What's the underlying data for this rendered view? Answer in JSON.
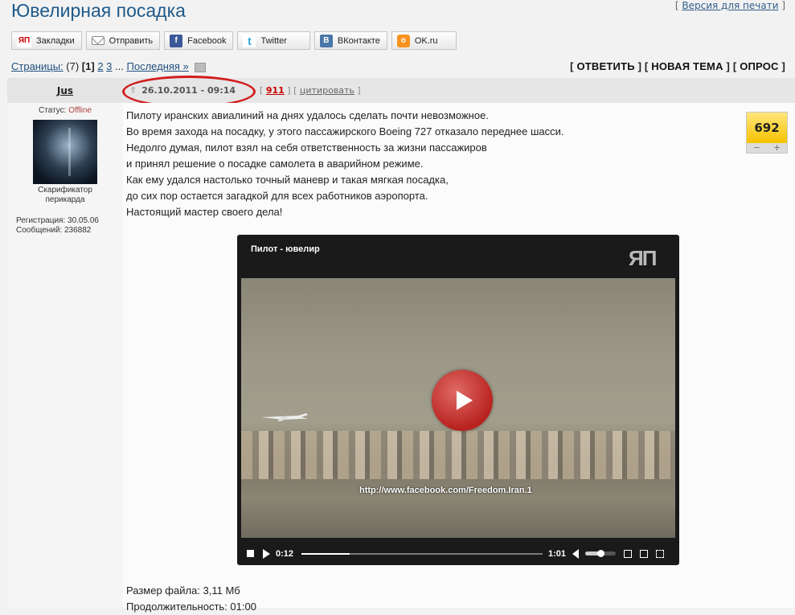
{
  "page": {
    "title": "Ювелирная посадка",
    "print_link": "Версия для печати"
  },
  "share": [
    {
      "label": "Закладки",
      "icon": "ЯП"
    },
    {
      "label": "Отправить",
      "icon": ""
    },
    {
      "label": "Facebook",
      "icon": "f"
    },
    {
      "label": "Twitter",
      "icon": "t"
    },
    {
      "label": "ВКонтакте",
      "icon": "В"
    },
    {
      "label": "OK.ru",
      "icon": "о"
    }
  ],
  "pagination": {
    "label": "Страницы:",
    "count": "(7)",
    "current": "[1]",
    "p2": "2",
    "p3": "3",
    "ellipsis": "...",
    "last": "Последняя »"
  },
  "actions": {
    "reply": "ОТВЕТИТЬ",
    "new_topic": "НОВАЯ ТЕМА",
    "poll": "ОПРОС"
  },
  "user": {
    "name": "Jus",
    "status_label": "Статус:",
    "status": "Offline",
    "rank": "Скарификатор перикарда",
    "registered": "Регистрация: 30.05.06",
    "messages": "Сообщений: 236882"
  },
  "post": {
    "date": "26.10.2011 - 09:14",
    "number": "911",
    "quote": "цитировать",
    "lines": [
      "Пилоту иранских авиалиний на днях удалось сделать почти невозможное.",
      "Во время захода на посадку, у этого пассажирского Boeing 727 отказало переднее шасси.",
      "Недолго думая, пилот взял на себя ответственность за жизни пассажиров",
      "и принял решение о посадке самолета в аварийном режиме.",
      "Как ему удался настолько точный маневр и такая мягкая посадка,",
      "до сих пор остается загадкой для всех работников аэропорта.",
      "Настоящий мастер своего дела!"
    ],
    "rating": "692",
    "rating_minus": "−",
    "rating_plus": "+"
  },
  "video": {
    "title": "Пилот - ювелир",
    "logo": "ЯП",
    "watermark": "http://www.facebook.com/Freedom.Iran.1",
    "current_time": "0:12",
    "duration": "1:01",
    "progress": 0.2,
    "volume": 0.5
  },
  "file": {
    "size": "Размер файла: 3,11 Мб",
    "duration": "Продолжительность: 01:00"
  },
  "colors": {
    "title": "#1f5a8a",
    "status_offline": "#b04040",
    "post_number": "#c00000",
    "highlight": "#d21d1d",
    "rating": "#f7c200"
  }
}
